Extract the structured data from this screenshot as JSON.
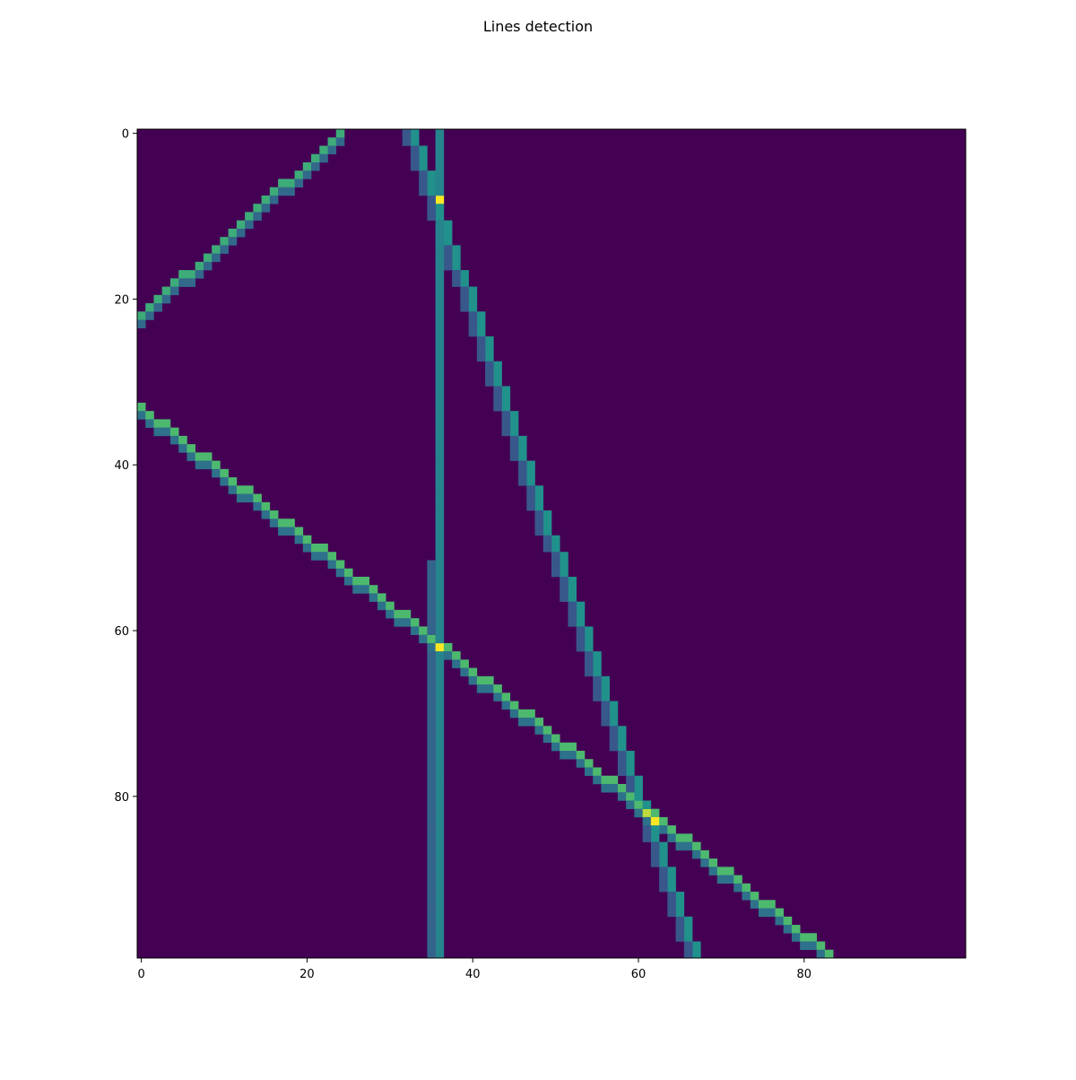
{
  "chart_data": {
    "type": "heatmap",
    "title": "Lines detection",
    "xlabel": "",
    "ylabel": "",
    "grid": false,
    "colormap": "viridis",
    "image_size": [
      100,
      100
    ],
    "xlim": [
      -0.5,
      99.5
    ],
    "ylim": [
      99.5,
      -0.5
    ],
    "x_ticks": [
      0,
      20,
      40,
      60,
      80
    ],
    "y_ticks": [
      0,
      20,
      40,
      60,
      80
    ],
    "x_tick_labels": [
      "0",
      "20",
      "40",
      "60",
      "80"
    ],
    "y_tick_labels": [
      "0",
      "20",
      "40",
      "60",
      "80"
    ],
    "background_value": 0,
    "max_value": 1,
    "lines": [
      {
        "from": [
          0,
          22
        ],
        "to": [
          24,
          0
        ],
        "value": 0.62
      },
      {
        "from": [
          0,
          33
        ],
        "to": [
          83,
          99
        ],
        "value": 0.68
      },
      {
        "from": [
          33,
          0
        ],
        "to": [
          67,
          99
        ],
        "value": 0.5
      },
      {
        "from": [
          36,
          0
        ],
        "to": [
          36,
          99
        ],
        "value": 0.45
      },
      {
        "from": [
          35,
          52
        ],
        "to": [
          35,
          99
        ],
        "value": 0.32
      }
    ],
    "highlight_cells": [
      {
        "x": 36,
        "y": 8,
        "value": 1
      },
      {
        "x": 36,
        "y": 62,
        "value": 1
      },
      {
        "x": 62,
        "y": 83,
        "value": 1
      },
      {
        "x": 61,
        "y": 82,
        "value": 0.9
      }
    ]
  }
}
